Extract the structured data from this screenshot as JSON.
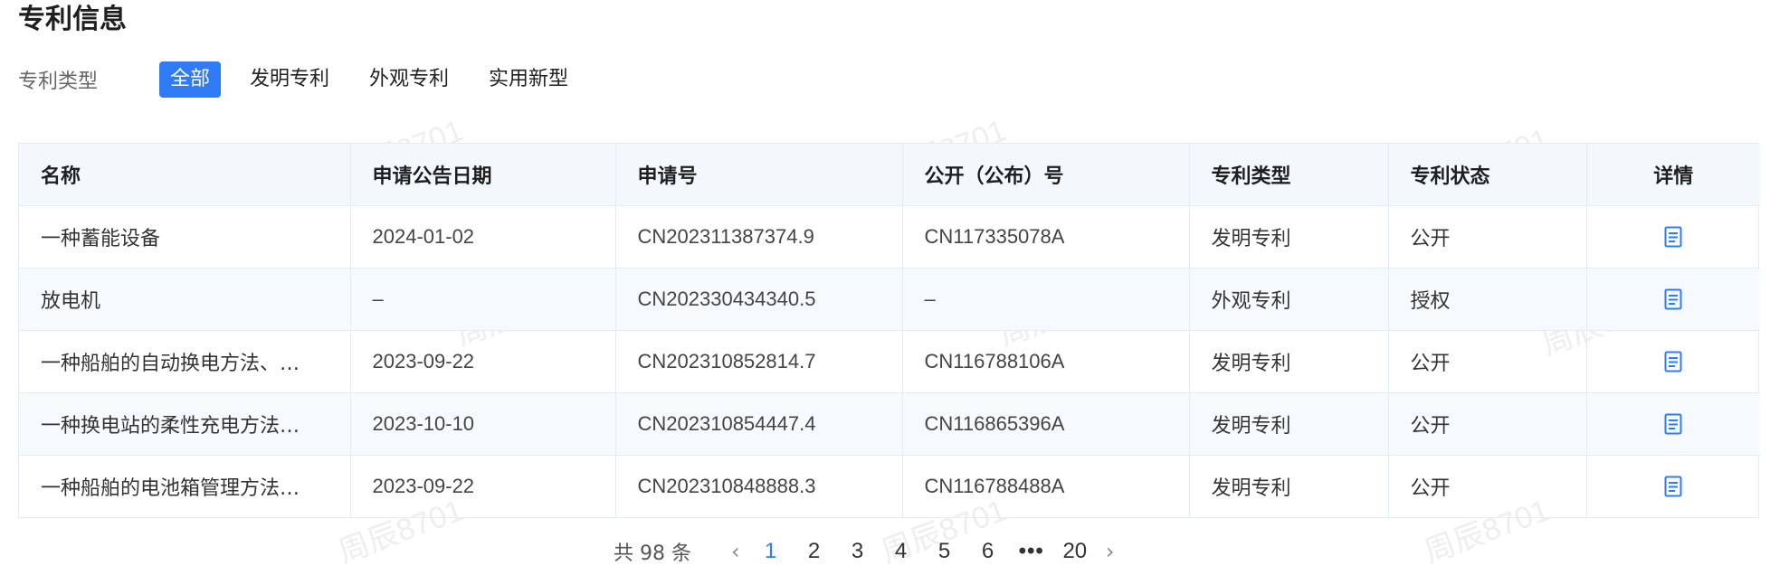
{
  "section": {
    "title": "专利信息"
  },
  "filter": {
    "label": "专利类型",
    "options": [
      {
        "label": "全部",
        "active": true
      },
      {
        "label": "发明专利",
        "active": false
      },
      {
        "label": "外观专利",
        "active": false
      },
      {
        "label": "实用新型",
        "active": false
      }
    ]
  },
  "table": {
    "headers": [
      "名称",
      "申请公告日期",
      "申请号",
      "公开（公布）号",
      "专利类型",
      "专利状态",
      "详情"
    ],
    "rows": [
      {
        "name": "一种蓄能设备",
        "date": "2024-01-02",
        "app_no": "CN202311387374.9",
        "pub_no": "CN117335078A",
        "type": "发明专利",
        "status": "公开"
      },
      {
        "name": "放电机",
        "date": "–",
        "app_no": "CN202330434340.5",
        "pub_no": "–",
        "type": "外观专利",
        "status": "授权"
      },
      {
        "name": "一种船舶的自动换电方法、…",
        "date": "2023-09-22",
        "app_no": "CN202310852814.7",
        "pub_no": "CN116788106A",
        "type": "发明专利",
        "status": "公开"
      },
      {
        "name": "一种换电站的柔性充电方法…",
        "date": "2023-10-10",
        "app_no": "CN202310854447.4",
        "pub_no": "CN116865396A",
        "type": "发明专利",
        "status": "公开"
      },
      {
        "name": "一种船舶的电池箱管理方法…",
        "date": "2023-09-22",
        "app_no": "CN202310848888.3",
        "pub_no": "CN116788488A",
        "type": "发明专利",
        "status": "公开"
      }
    ],
    "detail_icon": "document-icon"
  },
  "pagination": {
    "total_text": "共 98 条",
    "pages": [
      "1",
      "2",
      "3",
      "4",
      "5",
      "6"
    ],
    "ellipsis": "•••",
    "last_page": "20",
    "current": "1",
    "prev_icon": "chevron-left-icon",
    "next_icon": "chevron-right-icon"
  },
  "watermark": {
    "text": "周辰8701"
  },
  "colors": {
    "accent": "#2f7bf5",
    "header_bg": "#f3f8fc",
    "border": "#e4ebf3"
  }
}
